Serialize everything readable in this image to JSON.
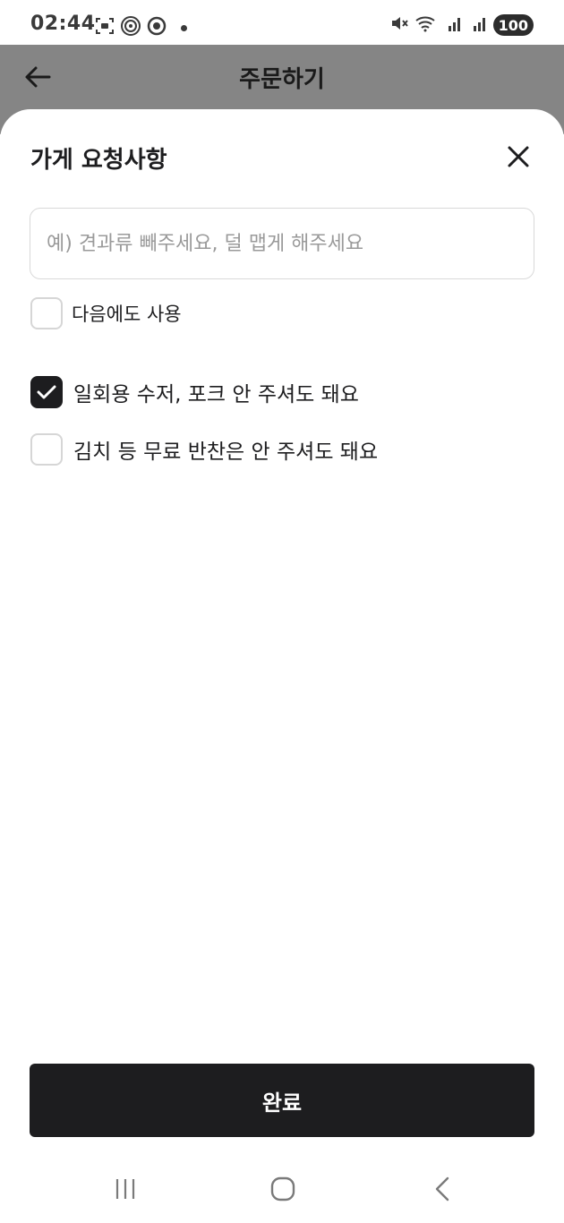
{
  "status_bar": {
    "time": "02:44",
    "battery": "100",
    "left_icons": [
      "screenshot-icon",
      "hotspot-icon",
      "record-icon"
    ],
    "right_icons": [
      "mute-icon",
      "wifi-icon",
      "signal-r-icon",
      "signal-r2-icon"
    ]
  },
  "header": {
    "title": "주문하기",
    "back_icon": "arrow-left-icon"
  },
  "sheet": {
    "title": "가게 요청사항",
    "close_icon": "close-icon",
    "input": {
      "value": "",
      "placeholder": "예) 견과류 빼주세요, 덜 맵게 해주세요"
    },
    "reuse_option": {
      "label": "다음에도 사용",
      "checked": false
    },
    "options": [
      {
        "label": "일회용 수저, 포크 안 주셔도 돼요",
        "checked": true
      },
      {
        "label": "김치 등 무료 반찬은 안 주셔도 돼요",
        "checked": false
      }
    ],
    "done_label": "완료"
  },
  "navbar": {
    "icons": [
      "recents-icon",
      "home-icon",
      "back-icon"
    ]
  },
  "colors": {
    "primary": "#1d1d1f",
    "dim_header": "#858585",
    "border": "#d9d9d9",
    "placeholder": "#9a9a9a"
  }
}
